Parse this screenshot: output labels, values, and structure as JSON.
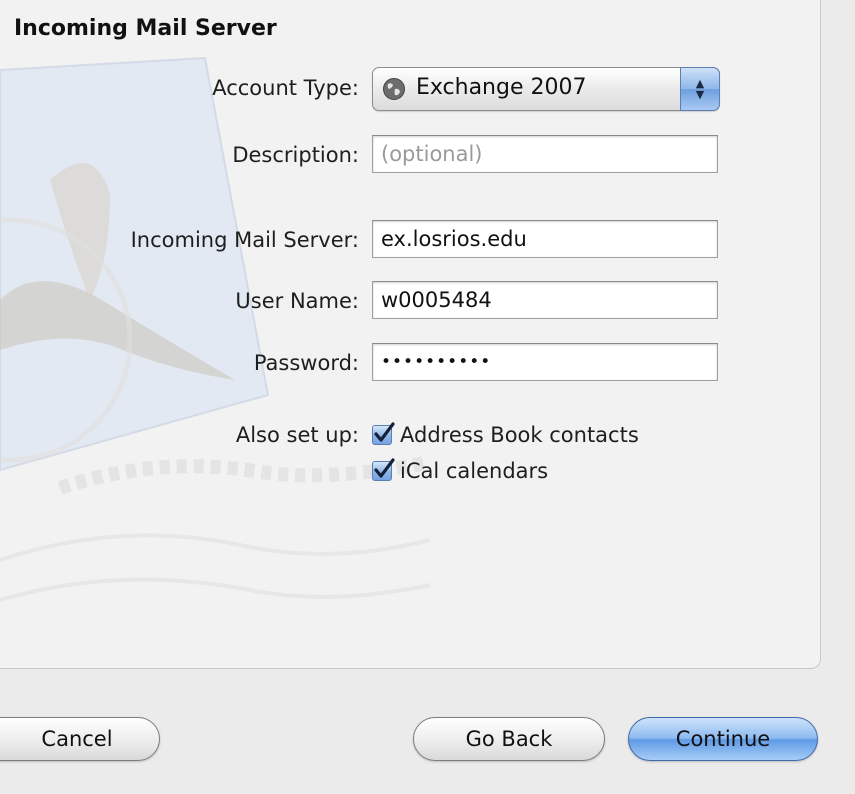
{
  "section_title": "Incoming Mail Server",
  "account_type": {
    "label": "Account Type:",
    "selected": "Exchange 2007",
    "icon": "globe-icon"
  },
  "description": {
    "label": "Description:",
    "value": "",
    "placeholder": "(optional)"
  },
  "incoming_server": {
    "label": "Incoming Mail Server:",
    "value": "ex.losrios.edu"
  },
  "user_name": {
    "label": "User Name:",
    "value": "w0005484"
  },
  "password": {
    "label": "Password:",
    "value": "••••••••••"
  },
  "also_set_up": {
    "label": "Also set up:",
    "options": [
      {
        "label": "Address Book contacts",
        "checked": true
      },
      {
        "label": "iCal calendars",
        "checked": true
      }
    ]
  },
  "buttons": {
    "cancel": "Cancel",
    "go_back": "Go Back",
    "continue": "Continue"
  },
  "colors": {
    "accent": "#6f9fe0",
    "window_background": "#ebebeb"
  }
}
